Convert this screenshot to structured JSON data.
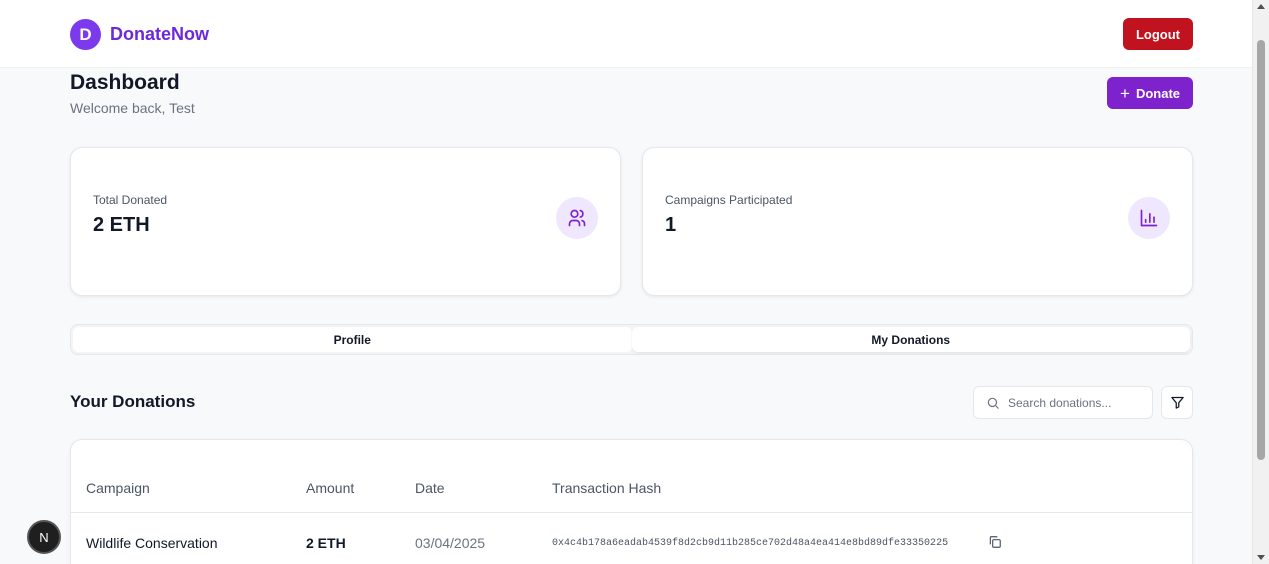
{
  "header": {
    "logo_letter": "D",
    "brand_name": "DonateNow",
    "logout_label": "Logout"
  },
  "dashboard": {
    "title": "Dashboard",
    "welcome": "Welcome back, Test",
    "donate_label": "Donate",
    "donate_icon": "plus-icon"
  },
  "stats": [
    {
      "label": "Total Donated",
      "value": "2 ETH",
      "icon": "users-icon"
    },
    {
      "label": "Campaigns Participated",
      "value": "1",
      "icon": "bar-chart-icon"
    }
  ],
  "tabs": [
    {
      "label": "Profile"
    },
    {
      "label": "My Donations",
      "active": true
    }
  ],
  "donations": {
    "title": "Your Donations",
    "search_placeholder": "Search donations...",
    "columns": [
      "Campaign",
      "Amount",
      "Date",
      "Transaction Hash"
    ],
    "rows": [
      {
        "campaign": "Wildlife Conservation",
        "amount": "2 ETH",
        "date": "03/04/2025",
        "hash": "0x4c4b178a6eadab4539f8d2cb9d11b285ce702d48a4ea414e8bd89dfe33350225"
      }
    ]
  },
  "dev_badge": "N",
  "colors": {
    "brand": "#6d28d9",
    "primary_button": "#7e22ce",
    "logout": "#c1121f",
    "icon_bg": "#efe7fd"
  }
}
